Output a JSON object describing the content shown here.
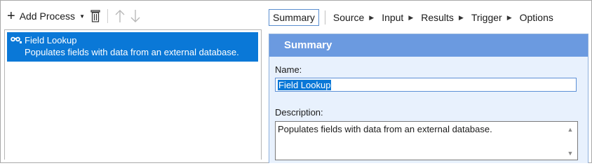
{
  "toolbar": {
    "add_process_label": "Add Process",
    "plus_icon": "plus-icon",
    "caret_icon": "chevron-down-icon",
    "delete_icon": "trash-icon",
    "move_up_icon": "arrow-up-icon",
    "move_down_icon": "arrow-down-icon"
  },
  "process_list": {
    "items": [
      {
        "title": "Field Lookup",
        "description": "Populates fields with data from an external database.",
        "icon": "lookup-icon",
        "selected": true
      }
    ]
  },
  "tabs": {
    "items": [
      {
        "label": "Summary",
        "active": true
      },
      {
        "label": "Source",
        "active": false
      },
      {
        "label": "Input",
        "active": false
      },
      {
        "label": "Results",
        "active": false
      },
      {
        "label": "Trigger",
        "active": false
      },
      {
        "label": "Options",
        "active": false
      }
    ],
    "separator_icon": "triangle-right-icon"
  },
  "summary_panel": {
    "header": "Summary",
    "name_label": "Name:",
    "name_value": "Field Lookup",
    "description_label": "Description:",
    "description_value": "Populates fields with data from an external database."
  },
  "colors": {
    "selection": "#0a78d7",
    "panel_header": "#6b9ae0",
    "panel_background": "#e8f1fd"
  }
}
